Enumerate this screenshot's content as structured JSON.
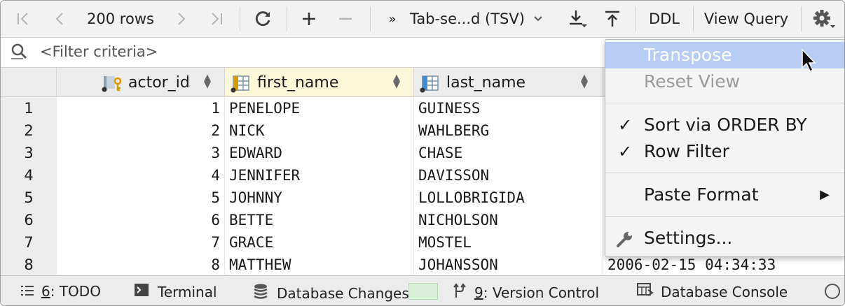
{
  "toolbar": {
    "first_page_icon": "first-page-icon",
    "prev_page_icon": "previous-page-icon",
    "rows_label": "200 rows",
    "next_page_icon": "next-page-icon",
    "last_page_icon": "last-page-icon",
    "refresh_icon": "refresh-icon",
    "add_icon": "add-row-icon",
    "remove_icon": "remove-row-icon",
    "format_prefix": "»",
    "format_label": "Tab-se...d (TSV)",
    "download_icon": "download-icon",
    "upload_icon": "upload-icon",
    "ddl_label": "DDL",
    "view_query_label": "View Query",
    "settings_icon": "gear-icon"
  },
  "filter": {
    "icon": "search-filter-icon",
    "placeholder": "<Filter criteria>"
  },
  "grid": {
    "columns": [
      {
        "name": "actor_id",
        "icon": "primary-key-column-icon"
      },
      {
        "name": "first_name",
        "icon": "column-icon"
      },
      {
        "name": "last_name",
        "icon": "column-icon"
      }
    ],
    "rows": [
      {
        "n": "1",
        "actor_id": "1",
        "first_name": "PENELOPE",
        "last_name": "GUINESS"
      },
      {
        "n": "2",
        "actor_id": "2",
        "first_name": "NICK",
        "last_name": "WAHLBERG"
      },
      {
        "n": "3",
        "actor_id": "3",
        "first_name": "EDWARD",
        "last_name": "CHASE"
      },
      {
        "n": "4",
        "actor_id": "4",
        "first_name": "JENNIFER",
        "last_name": "DAVISSON"
      },
      {
        "n": "5",
        "actor_id": "5",
        "first_name": "JOHNNY",
        "last_name": "LOLLOBRIGIDA"
      },
      {
        "n": "6",
        "actor_id": "6",
        "first_name": "BETTE",
        "last_name": "NICHOLSON"
      },
      {
        "n": "7",
        "actor_id": "7",
        "first_name": "GRACE",
        "last_name": "MOSTEL"
      },
      {
        "n": "8",
        "actor_id": "8",
        "first_name": "MATTHEW",
        "last_name": "JOHANSSON",
        "last_update": "2006-02-15 04:34:33"
      }
    ]
  },
  "menu": {
    "transpose": "Transpose",
    "reset_view": "Reset View",
    "sort_order_by": "Sort via ORDER BY",
    "row_filter": "Row Filter",
    "paste_format": "Paste Format",
    "settings": "Settings...",
    "check_mark": "✓",
    "submenu_arrow": "▶"
  },
  "status_bar": {
    "todo_key": "6",
    "todo_label": ": TODO",
    "terminal_label": "Terminal",
    "db_changes_label": "Database Changes",
    "vc_key": "9",
    "vc_label": ": Version Control",
    "db_console_label": "Database Console"
  },
  "colors": {
    "menu_highlight": "#b8cdf3",
    "selected_header": "#fdf7d9",
    "toolbar_bg": "#f2f2f2"
  }
}
